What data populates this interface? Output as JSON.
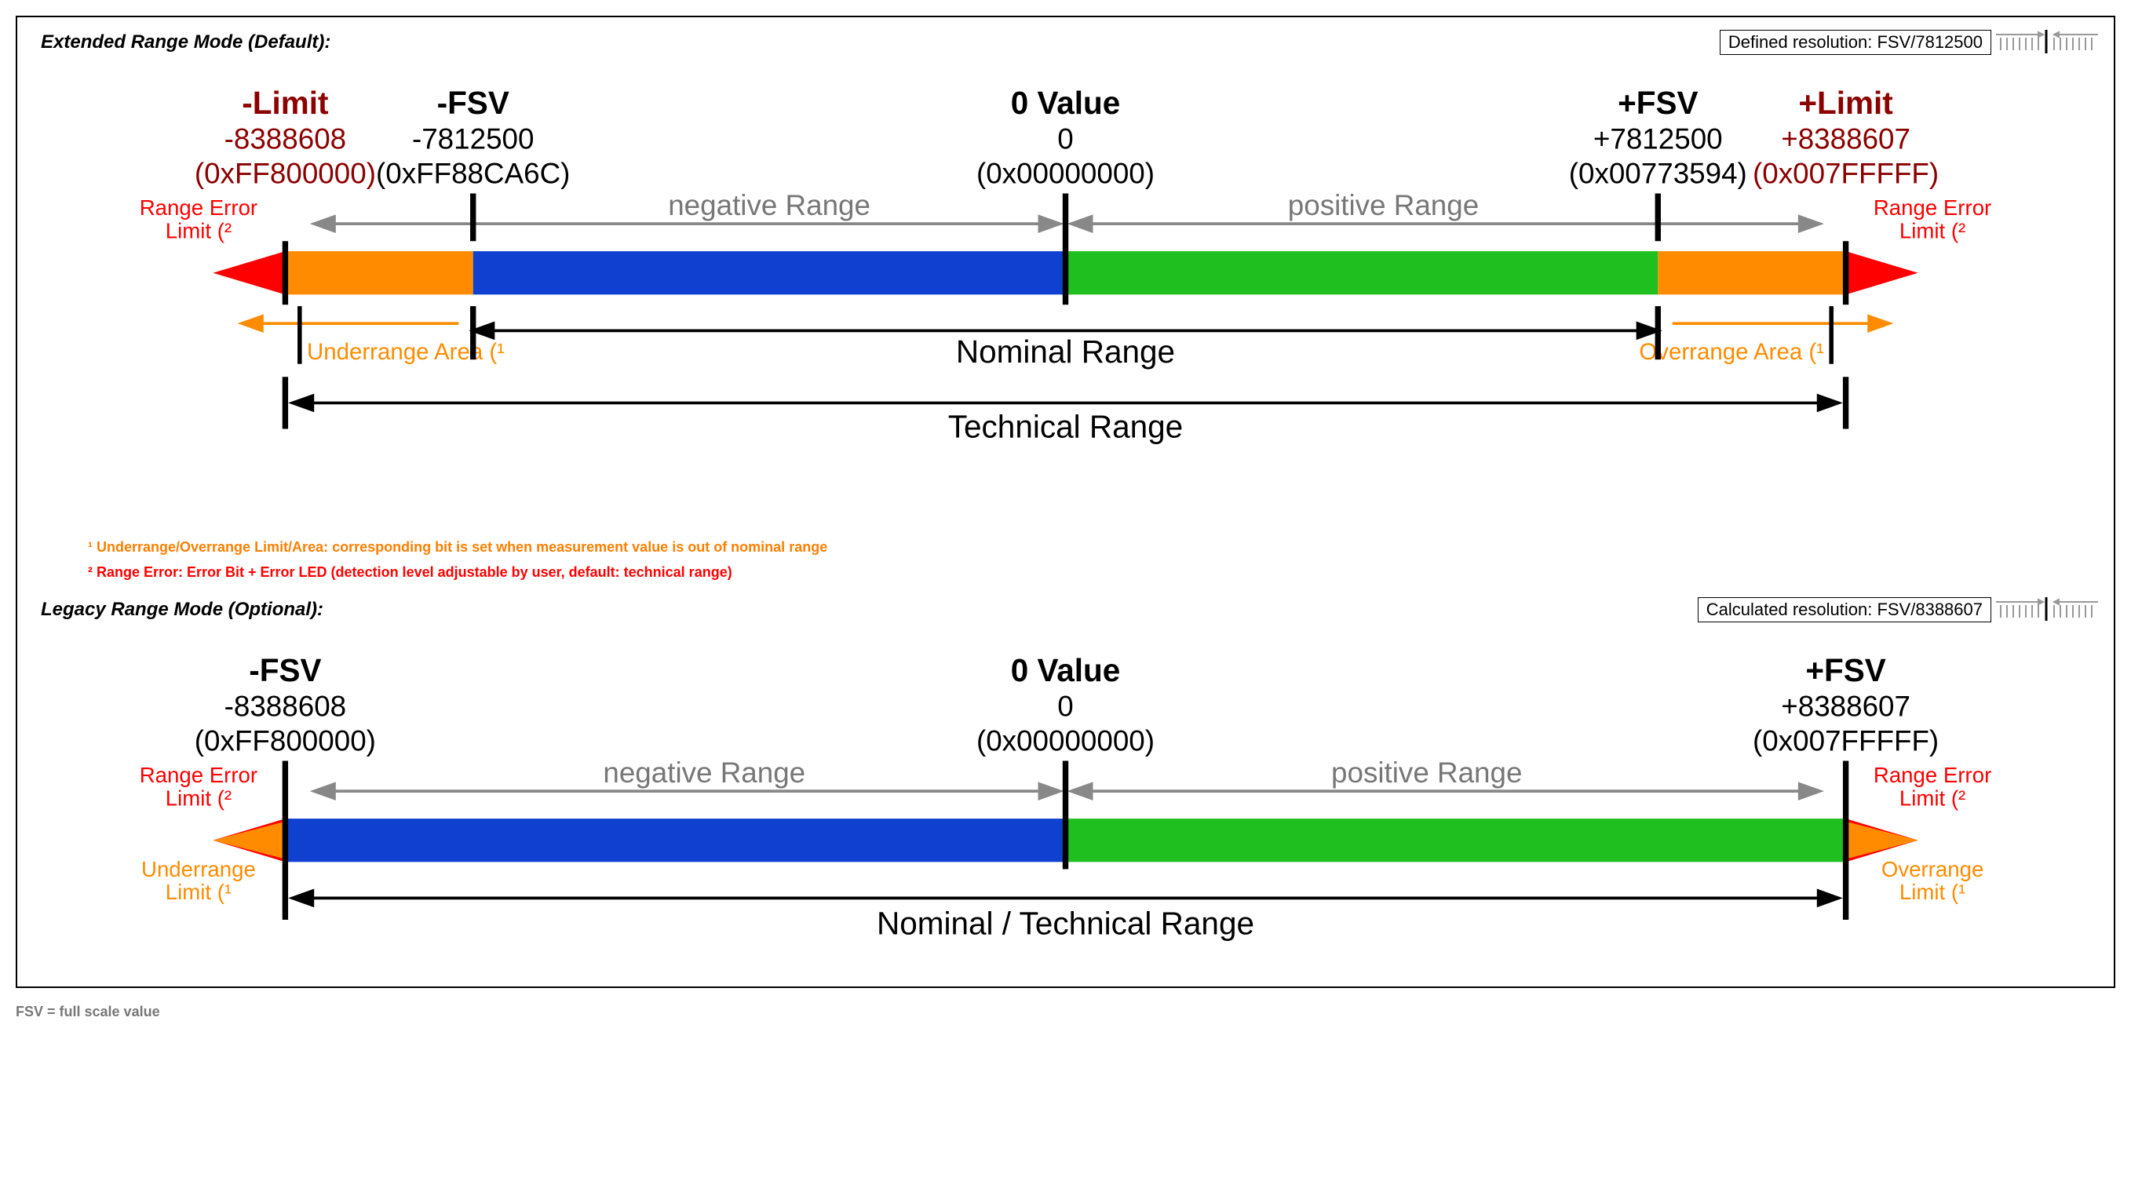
{
  "extended": {
    "title": "Extended Range Mode (Default):",
    "resolution_label": "Defined resolution:  FSV/7812500",
    "neg_limit": {
      "name": "-Limit",
      "dec": "-8388608",
      "hex": "(0xFF800000)"
    },
    "neg_fsv": {
      "name": "-FSV",
      "dec": "-7812500",
      "hex": "(0xFF88CA6C)"
    },
    "zero": {
      "name": "0 Value",
      "dec": "0",
      "hex": "(0x00000000)"
    },
    "pos_fsv": {
      "name": "+FSV",
      "dec": "+7812500",
      "hex": "(0x00773594)"
    },
    "pos_limit": {
      "name": "+Limit",
      "dec": "+8388607",
      "hex": "(0x007FFFFF)"
    },
    "neg_range_lbl": "negative Range",
    "pos_range_lbl": "positive Range",
    "nominal_lbl": "Nominal Range",
    "technical_lbl": "Technical Range",
    "underrange_area": "Underrange Area (¹",
    "overrange_area": "Overrange Area (¹",
    "range_error_l": "Range Error",
    "range_error_limit": "Limit (²"
  },
  "legacy": {
    "title": "Legacy Range Mode (Optional):",
    "resolution_label": "Calculated resolution:  FSV/8388607",
    "neg_fsv": {
      "name": "-FSV",
      "dec": "-8388608",
      "hex": "(0xFF800000)"
    },
    "zero": {
      "name": "0 Value",
      "dec": "0",
      "hex": "(0x00000000)"
    },
    "pos_fsv": {
      "name": "+FSV",
      "dec": "+8388607",
      "hex": "(0x007FFFFF)"
    },
    "neg_range_lbl": "negative Range",
    "pos_range_lbl": "positive Range",
    "nominal_tech_lbl": "Nominal / Technical Range",
    "underrange_limit": "Underrange",
    "overrange_limit": "Overrange",
    "limit_sup": "Limit (¹",
    "range_error_l": "Range Error",
    "range_error_limit": "Limit (²"
  },
  "footnotes": {
    "f1": "¹ Underrange/Overrange Limit/Area: corresponding bit is set when measurement value is out of nominal range",
    "f2": "² Range Error: Error Bit + Error LED (detection level adjustable by user, default: technical range)"
  },
  "fsv_note": "FSV = full scale value"
}
